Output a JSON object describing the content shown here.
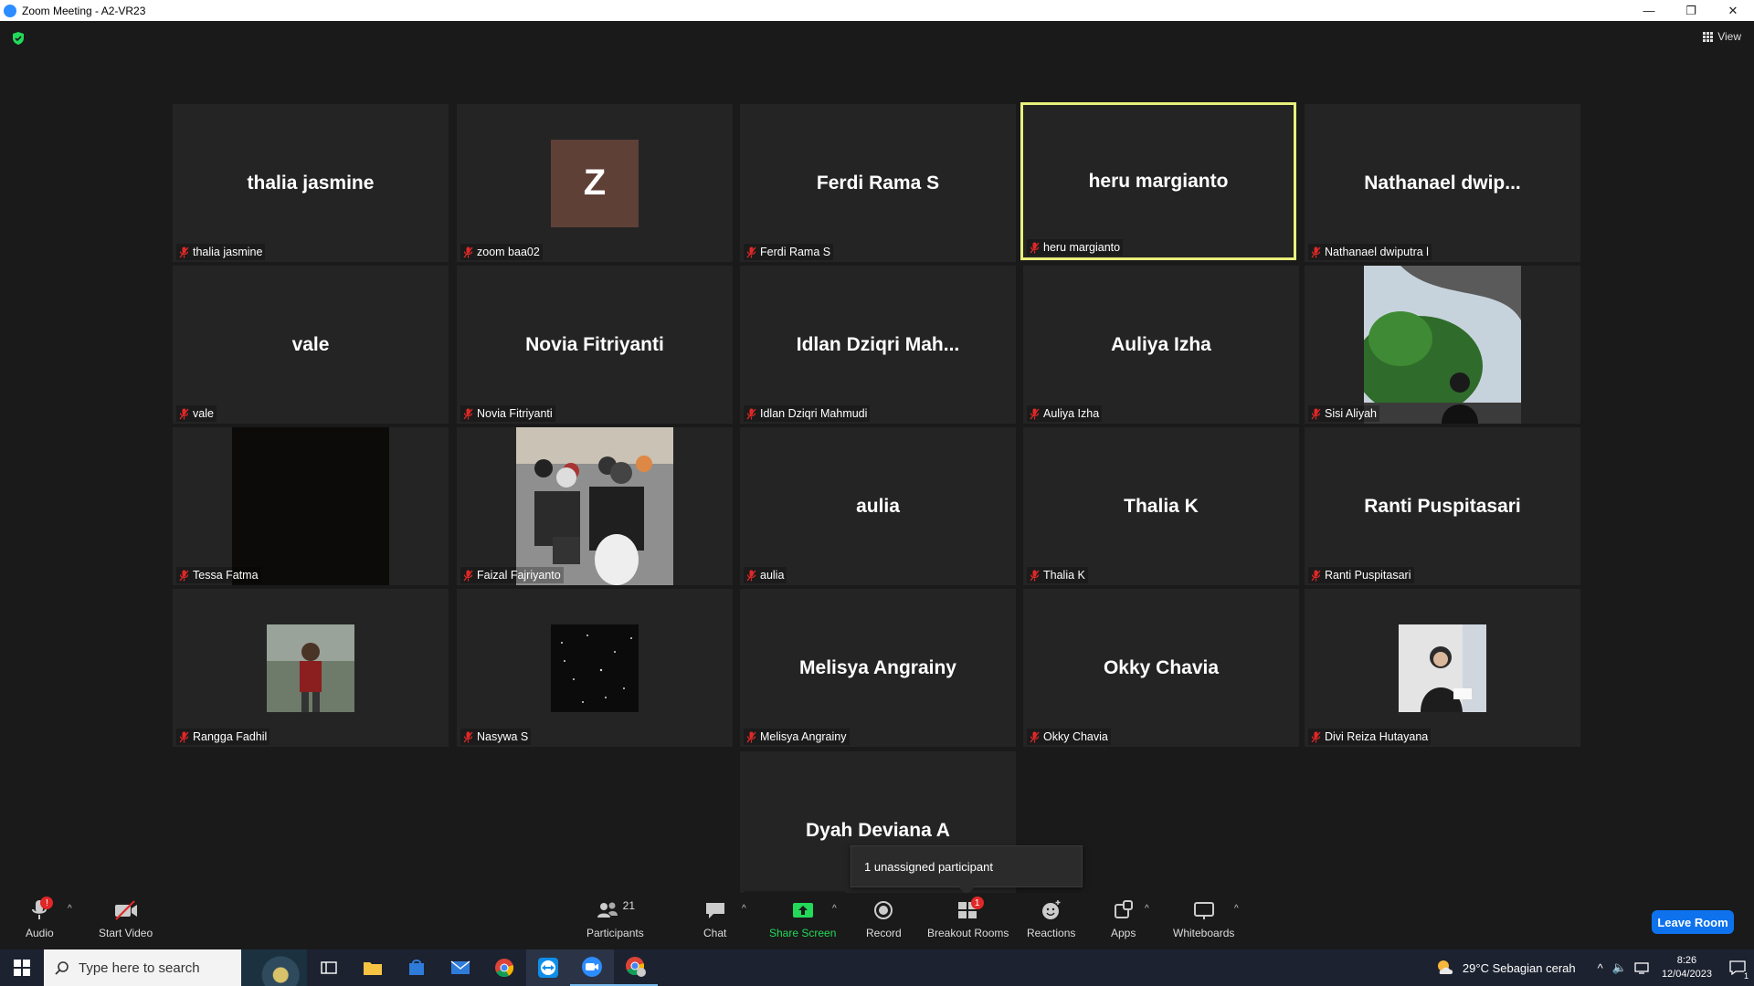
{
  "window": {
    "title": "Zoom Meeting - A2-VR23"
  },
  "top": {
    "view_label": "View"
  },
  "tiles": [
    {
      "big": "thalia jasmine",
      "label": "thalia jasmine"
    },
    {
      "big": "Z",
      "label": "zoom baa02"
    },
    {
      "big": "Ferdi Rama S",
      "label": "Ferdi Rama S"
    },
    {
      "big": "heru margianto",
      "label": "heru margianto"
    },
    {
      "big": "Nathanael  dwip...",
      "label": "Nathanael dwiputra l"
    },
    {
      "big": "vale",
      "label": "vale"
    },
    {
      "big": "Novia Fitriyanti",
      "label": "Novia Fitriyanti"
    },
    {
      "big": "Idlan  Dziqri  Mah...",
      "label": "Idlan Dziqri Mahmudi"
    },
    {
      "big": "Auliya Izha",
      "label": "Auliya Izha"
    },
    {
      "big": "",
      "label": "Sisi Aliyah"
    },
    {
      "big": "",
      "label": "Tessa Fatma"
    },
    {
      "big": "",
      "label": "Faizal Fajriyanto"
    },
    {
      "big": "aulia",
      "label": "aulia"
    },
    {
      "big": "Thalia K",
      "label": "Thalia K"
    },
    {
      "big": "Ranti Puspitasari",
      "label": "Ranti Puspitasari"
    },
    {
      "big": "",
      "label": "Rangga Fadhil"
    },
    {
      "big": "",
      "label": "Nasywa S"
    },
    {
      "big": "Melisya Angrainy",
      "label": "Melisya Angrainy"
    },
    {
      "big": "Okky Chavia",
      "label": "Okky Chavia"
    },
    {
      "big": "",
      "label": "Divi Reiza Hutayana"
    },
    {
      "big": "Dyah Deviana A",
      "label": "Dyah Deviana A"
    }
  ],
  "tooltip": "1 unassigned participant",
  "toolbar": {
    "audio": "Audio",
    "audio_badge": "!",
    "start_video": "Start Video",
    "participants": "Participants",
    "participants_count": "21",
    "chat": "Chat",
    "share_screen": "Share Screen",
    "record": "Record",
    "breakout_rooms": "Breakout Rooms",
    "breakout_badge": "1",
    "reactions": "Reactions",
    "apps": "Apps",
    "whiteboards": "Whiteboards",
    "leave": "Leave Room"
  },
  "taskbar": {
    "search_placeholder": "Type here to search",
    "weather": "29°C  Sebagian cerah",
    "time": "8:26",
    "date": "12/04/2023",
    "notif_count": "1"
  },
  "colors": {
    "accent": "#0e72ed",
    "active_speaker": "#e8f07c",
    "share_green": "#23d959",
    "muted_red": "#e02828"
  }
}
